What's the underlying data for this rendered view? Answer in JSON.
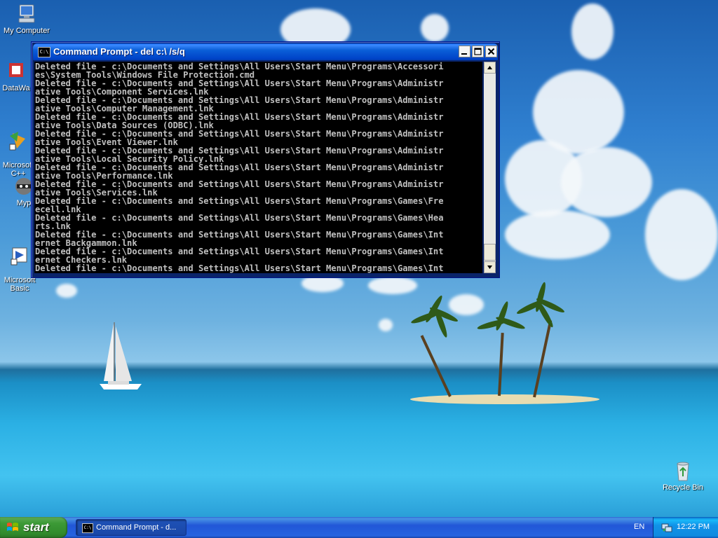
{
  "desktop": {
    "icons": [
      {
        "label": "My Computer"
      },
      {
        "label": "DataWa"
      },
      {
        "label": "Microsoft\nC++"
      },
      {
        "label": "Myp"
      },
      {
        "label": "Microsoft\nBasic"
      },
      {
        "label": "Recycle Bin"
      }
    ]
  },
  "window": {
    "title": "Command Prompt - del c:\\ /s/q",
    "icon_text": "C:\\"
  },
  "console": {
    "lines": [
      "Deleted file - c:\\Documents and Settings\\All Users\\Start Menu\\Programs\\Accessori",
      "es\\System Tools\\Windows File Protection.cmd",
      "Deleted file - c:\\Documents and Settings\\All Users\\Start Menu\\Programs\\Administr",
      "ative Tools\\Component Services.lnk",
      "Deleted file - c:\\Documents and Settings\\All Users\\Start Menu\\Programs\\Administr",
      "ative Tools\\Computer Management.lnk",
      "Deleted file - c:\\Documents and Settings\\All Users\\Start Menu\\Programs\\Administr",
      "ative Tools\\Data Sources (ODBC).lnk",
      "Deleted file - c:\\Documents and Settings\\All Users\\Start Menu\\Programs\\Administr",
      "ative Tools\\Event Viewer.lnk",
      "Deleted file - c:\\Documents and Settings\\All Users\\Start Menu\\Programs\\Administr",
      "ative Tools\\Local Security Policy.lnk",
      "Deleted file - c:\\Documents and Settings\\All Users\\Start Menu\\Programs\\Administr",
      "ative Tools\\Performance.lnk",
      "Deleted file - c:\\Documents and Settings\\All Users\\Start Menu\\Programs\\Administr",
      "ative Tools\\Services.lnk",
      "Deleted file - c:\\Documents and Settings\\All Users\\Start Menu\\Programs\\Games\\Fre",
      "ecell.lnk",
      "Deleted file - c:\\Documents and Settings\\All Users\\Start Menu\\Programs\\Games\\Hea",
      "rts.lnk",
      "Deleted file - c:\\Documents and Settings\\All Users\\Start Menu\\Programs\\Games\\Int",
      "ernet Backgammon.lnk",
      "Deleted file - c:\\Documents and Settings\\All Users\\Start Menu\\Programs\\Games\\Int",
      "ernet Checkers.lnk",
      "Deleted file - c:\\Documents and Settings\\All Users\\Start Menu\\Programs\\Games\\Int"
    ]
  },
  "taskbar": {
    "start_label": "start",
    "task_label": "Command Prompt - d...",
    "language": "EN",
    "clock": "12:22 PM"
  },
  "colors": {
    "console_bg": "#000000",
    "console_fg": "#c0c0c0",
    "titlebar": "#0a5fd8",
    "taskbar": "#2157d7",
    "start_green": "#3c9a36"
  }
}
